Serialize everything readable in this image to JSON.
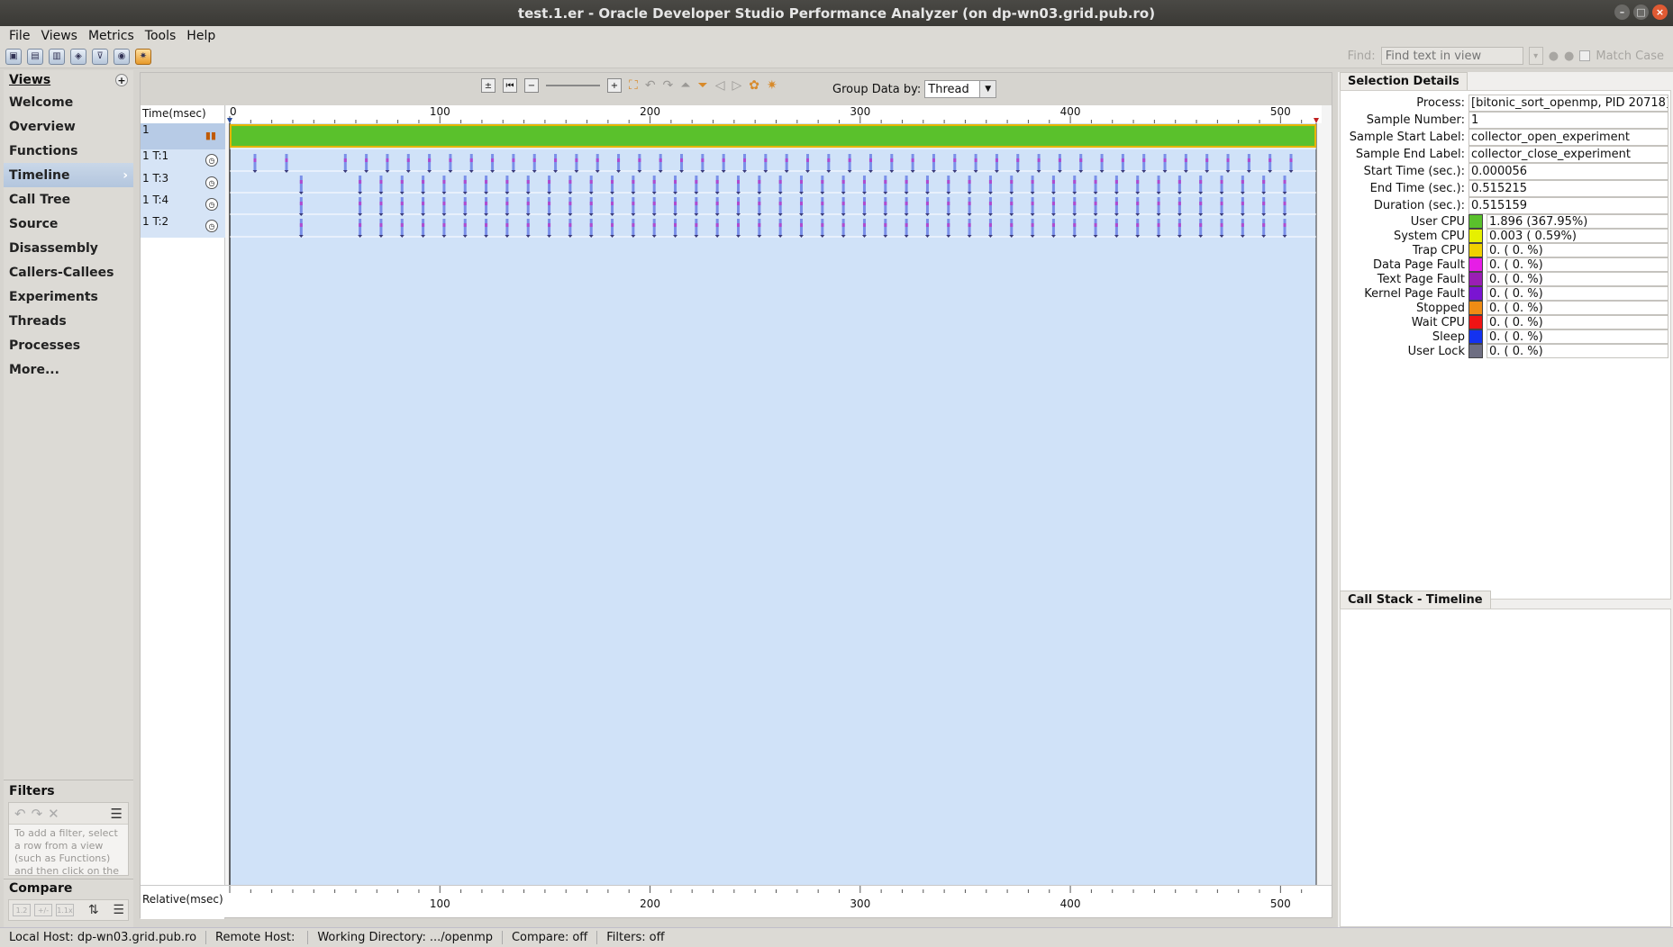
{
  "window": {
    "title": "test.1.er  -  Oracle Developer Studio Performance Analyzer (on dp-wn03.grid.pub.ro)"
  },
  "menu": [
    "File",
    "Views",
    "Metrics",
    "Tools",
    "Help"
  ],
  "find": {
    "label": "Find:",
    "placeholder": "Find text in view",
    "match_case": "Match Case"
  },
  "views": {
    "header": "Views",
    "items": [
      "Welcome",
      "Overview",
      "Functions",
      "Timeline",
      "Call Tree",
      "Source",
      "Disassembly",
      "Callers-Callees",
      "Experiments",
      "Threads",
      "Processes",
      "More..."
    ],
    "active": "Timeline"
  },
  "filters": {
    "header": "Filters",
    "hint": "To add a filter, select a row from a view (such as Functions) and then click on the"
  },
  "compare": {
    "header": "Compare",
    "buttons": [
      "1.2",
      "+/-",
      "1.1x"
    ]
  },
  "timeline": {
    "group_by_label": "Group Data by:",
    "group_by_value": "Thread",
    "axis_top_label": "Time(msec)",
    "axis_bottom_label": "Relative(msec)",
    "ticks": [
      0,
      100,
      200,
      300,
      400,
      500
    ],
    "max_ms": 517,
    "rows": [
      {
        "label": "1",
        "type": "process"
      },
      {
        "label": "1 T:1",
        "type": "thread"
      },
      {
        "label": "1 T:3",
        "type": "thread"
      },
      {
        "label": "1 T:4",
        "type": "thread"
      },
      {
        "label": "1 T:2",
        "type": "thread"
      }
    ],
    "thread_event_times_ms": [
      [
        12,
        27,
        55,
        65,
        75,
        85,
        95,
        105,
        115,
        125,
        135,
        145,
        155,
        165,
        175,
        185,
        195,
        205,
        215,
        225,
        235,
        245,
        255,
        265,
        275,
        285,
        295,
        305,
        315,
        325,
        335,
        345,
        355,
        365,
        375,
        385,
        395,
        405,
        415,
        425,
        435,
        445,
        455,
        465,
        475,
        485,
        495,
        505
      ],
      [
        34,
        62,
        72,
        82,
        92,
        102,
        112,
        122,
        132,
        142,
        152,
        162,
        172,
        182,
        192,
        202,
        212,
        222,
        232,
        242,
        252,
        262,
        272,
        282,
        292,
        302,
        312,
        322,
        332,
        342,
        352,
        362,
        372,
        382,
        392,
        402,
        412,
        422,
        432,
        442,
        452,
        462,
        472,
        482,
        492,
        502
      ],
      [
        34,
        62,
        72,
        82,
        92,
        102,
        112,
        122,
        132,
        142,
        152,
        162,
        172,
        182,
        192,
        202,
        212,
        222,
        232,
        242,
        252,
        262,
        272,
        282,
        292,
        302,
        312,
        322,
        332,
        342,
        352,
        362,
        372,
        382,
        392,
        402,
        412,
        422,
        432,
        442,
        452,
        462,
        472,
        482,
        492,
        502
      ],
      [
        34,
        62,
        72,
        82,
        92,
        102,
        112,
        122,
        132,
        142,
        152,
        162,
        172,
        182,
        192,
        202,
        212,
        222,
        232,
        242,
        252,
        262,
        272,
        282,
        292,
        302,
        312,
        322,
        332,
        342,
        352,
        362,
        372,
        382,
        392,
        402,
        412,
        422,
        432,
        442,
        452,
        462,
        472,
        482,
        492,
        502
      ]
    ]
  },
  "selection_details": {
    "tab": "Selection Details",
    "fields": [
      {
        "label": "Process:",
        "value": "[bitonic_sort_openmp, PID 20718]"
      },
      {
        "label": "Sample Number:",
        "value": "1"
      },
      {
        "label": "Sample Start Label:",
        "value": "collector_open_experiment"
      },
      {
        "label": "Sample End Label:",
        "value": "collector_close_experiment"
      },
      {
        "label": "Start Time (sec.):",
        "value": "0.000056"
      },
      {
        "label": "End Time (sec.):",
        "value": "0.515215"
      },
      {
        "label": "Duration (sec.):",
        "value": "0.515159"
      }
    ],
    "states": [
      {
        "label": "User CPU",
        "color": "#5ac12c",
        "value": "1.896 (367.95%)"
      },
      {
        "label": "System CPU",
        "color": "#e6f000",
        "value": "0.003 (  0.59%)"
      },
      {
        "label": "Trap CPU",
        "color": "#f0d000",
        "value": "0.    (  0.  %)"
      },
      {
        "label": "Data Page Fault",
        "color": "#e61ee6",
        "value": "0.    (  0.  %)"
      },
      {
        "label": "Text Page Fault",
        "color": "#9a1eb4",
        "value": "0.    (  0.  %)"
      },
      {
        "label": "Kernel Page Fault",
        "color": "#7a14d2",
        "value": "0.    (  0.  %)"
      },
      {
        "label": "Stopped",
        "color": "#f08c14",
        "value": "0.    (  0.  %)"
      },
      {
        "label": "Wait CPU",
        "color": "#f01414",
        "value": "0.    (  0.  %)"
      },
      {
        "label": "Sleep",
        "color": "#1432f0",
        "value": "0.    (  0.  %)"
      },
      {
        "label": "User Lock",
        "color": "#6e6e82",
        "value": "0.    (  0.  %)"
      }
    ]
  },
  "call_stack": {
    "tab": "Call Stack - Timeline"
  },
  "status": {
    "local_host_label": "Local Host:",
    "local_host": "dp-wn03.grid.pub.ro",
    "remote_host_label": "Remote Host:",
    "remote_host": "",
    "working_dir_label": "Working Directory:",
    "working_dir": ".../openmp",
    "compare_label": "Compare:",
    "compare": "off",
    "filters_label": "Filters:",
    "filters": "off"
  }
}
